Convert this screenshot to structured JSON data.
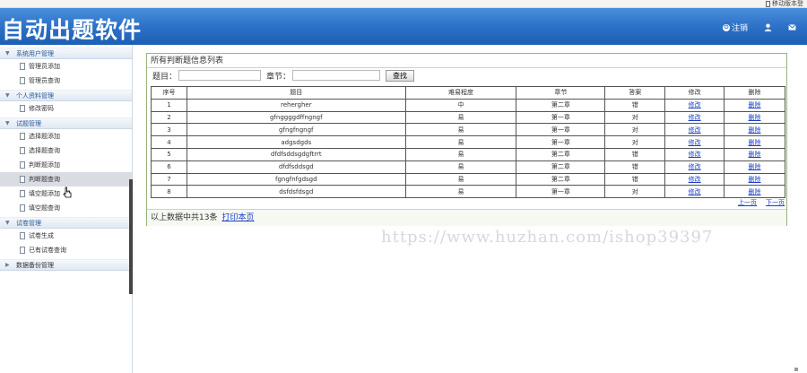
{
  "topbar": {
    "mobile_label": "移动版本登"
  },
  "header": {
    "title": "自动出题软件",
    "logout_label": "注销",
    "user_icon": "user-icon",
    "mail_icon": "mail-icon"
  },
  "sidebar": {
    "groups": [
      {
        "label": "系统用户管理",
        "items": [
          "管理员添加",
          "管理员查询"
        ]
      },
      {
        "label": "个人资料管理",
        "items": [
          "修改密码"
        ]
      },
      {
        "label": "试题管理",
        "items": [
          "选择题添加",
          "选择题查询",
          "判断题添加",
          "判断题查询",
          "填空题添加",
          "填空题查询"
        ]
      },
      {
        "label": "试卷管理",
        "items": [
          "试卷生成",
          "已有试卷查询"
        ]
      },
      {
        "label": "数据备份管理",
        "items": []
      }
    ]
  },
  "panel": {
    "title": "所有判断题信息列表",
    "search": {
      "topic_label": "题目：",
      "topic_value": "",
      "chapter_label": "章节：",
      "chapter_value": "",
      "button": "查找"
    },
    "table": {
      "headers": [
        "序号",
        "题目",
        "难易程度",
        "章节",
        "答案",
        "修改",
        "删除"
      ],
      "rows": [
        [
          "1",
          "rehergher",
          "中",
          "第二章",
          "错",
          "修改",
          "删除"
        ],
        [
          "2",
          "gfnggggdffngngf",
          "易",
          "第一章",
          "对",
          "修改",
          "删除"
        ],
        [
          "3",
          "gfngfngngf",
          "易",
          "第一章",
          "对",
          "修改",
          "删除"
        ],
        [
          "4",
          "adgsdgds",
          "易",
          "第一章",
          "对",
          "修改",
          "删除"
        ],
        [
          "5",
          "dfdfsddsgdgftrrt",
          "易",
          "第二章",
          "错",
          "修改",
          "删除"
        ],
        [
          "6",
          "dfdfsddsgd",
          "易",
          "第二章",
          "错",
          "修改",
          "删除"
        ],
        [
          "7",
          "fgngfnfgdsgd",
          "易",
          "第二章",
          "错",
          "修改",
          "删除"
        ],
        [
          "8",
          "dsfdsfdsgd",
          "易",
          "第一章",
          "对",
          "修改",
          "删除"
        ]
      ]
    },
    "pager": {
      "prev": "上一页",
      "next": "下一页"
    },
    "footer": {
      "summary": "以上数据中共13条",
      "print_link": "打印本页"
    }
  },
  "watermark": "https://www.huzhan.com/ishop39397",
  "colors": {
    "header": "#2f74c9",
    "link": "#1a3fc7",
    "panel_border": "#98b37c"
  }
}
